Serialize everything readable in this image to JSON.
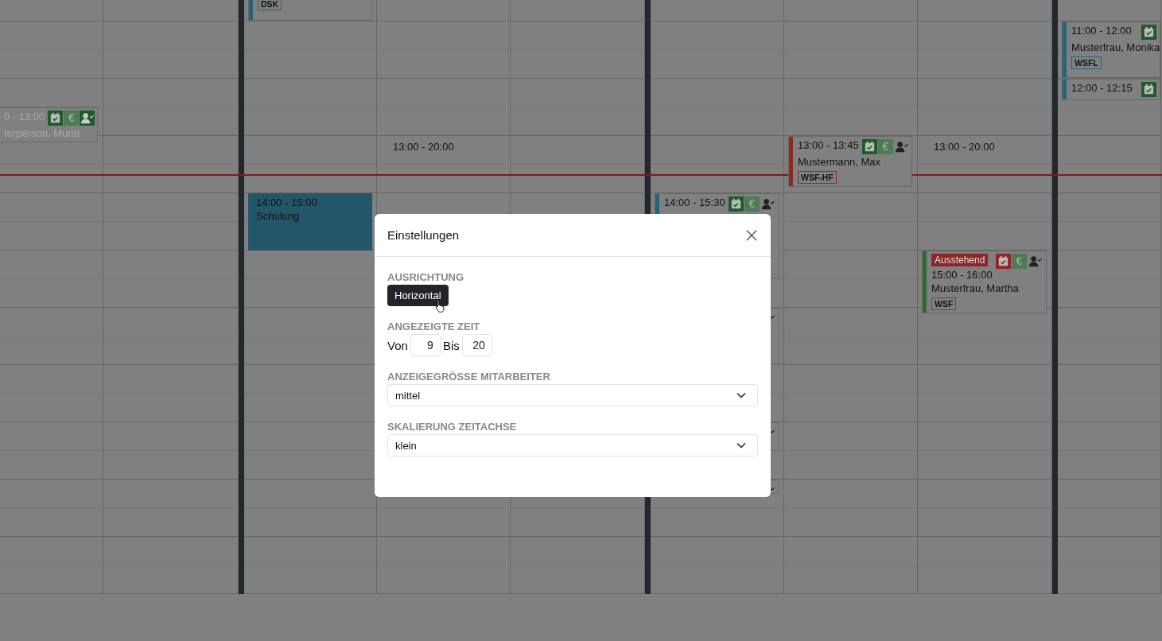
{
  "calendar": {
    "columns": [
      {
        "events": [
          {
            "kind": "appointment",
            "time": "0 - 13:00",
            "name": "terperson, Murat",
            "faded": true,
            "status": {
              "color": "#1e5a2a"
            },
            "currency": "€",
            "person_assigned": true
          }
        ]
      },
      {},
      {
        "events": [
          {
            "kind": "appointment",
            "color": "#24647c",
            "tags": [
              {
                "label": "DSK",
                "color": "#24647c"
              }
            ]
          },
          {
            "kind": "block",
            "time": "14:00 - 15:00",
            "name": "Schulung",
            "color": "#24566a"
          }
        ]
      },
      {
        "shift": "13:00 - 20:00"
      },
      {},
      {
        "events": [
          {
            "kind": "appointment",
            "time": "14:00 - 15:30",
            "color": "#24647c",
            "status": {
              "color": "#1e5a2a"
            },
            "currency": "€",
            "person_assigned": false
          }
        ]
      },
      {
        "events": [
          {
            "kind": "appointment",
            "time": "13:00 - 13:45",
            "name": "Mustermann, Max",
            "color": "#8a2a20",
            "status": {
              "color": "#1e5a2a"
            },
            "currency": "€",
            "person_assigned": false,
            "tags": [
              {
                "label": "WSF-HF",
                "color": "#8a2a20"
              }
            ]
          }
        ]
      },
      {
        "shift": "13:00 - 20:00",
        "events": [
          {
            "kind": "appointment",
            "badge": "Ausstehend",
            "time": "15:00 - 16:00",
            "name": "Musterfrau, Martha",
            "color": "#2e6b32",
            "status": {
              "color": "#8f2626"
            },
            "currency": "€",
            "person_assigned": false,
            "tags": [
              {
                "label": "WSF",
                "color": "#2e6b32"
              }
            ]
          }
        ]
      },
      {
        "events": [
          {
            "kind": "appointment",
            "time": "11:00 - 12:00",
            "name": "Musterfrau, Monika",
            "color": "#24647c",
            "status": {
              "color": "#1e5a2a"
            },
            "tags": [
              {
                "label": "WSFL",
                "color": "#24647c"
              }
            ]
          },
          {
            "kind": "appointment",
            "time": "12:00 - 12:15",
            "color": "#24647c",
            "status": {
              "color": "#1e5a2a"
            }
          }
        ]
      }
    ]
  },
  "dialog": {
    "title": "Einstellungen",
    "sections": [
      {
        "kind": "button",
        "label": "AUSRICHTUNG",
        "button": "Horizontal"
      },
      {
        "kind": "range",
        "label": "ANGEZEIGTE ZEIT",
        "from_label": "Von",
        "from": "9",
        "to_label": "Bis",
        "to": "20"
      },
      {
        "kind": "select",
        "label": "ANZEIGEGRÖSSE MITARBEITER",
        "value": "mittel"
      },
      {
        "kind": "select",
        "label": "SKALIERUNG ZEITACHSE",
        "value": "klein"
      }
    ]
  }
}
